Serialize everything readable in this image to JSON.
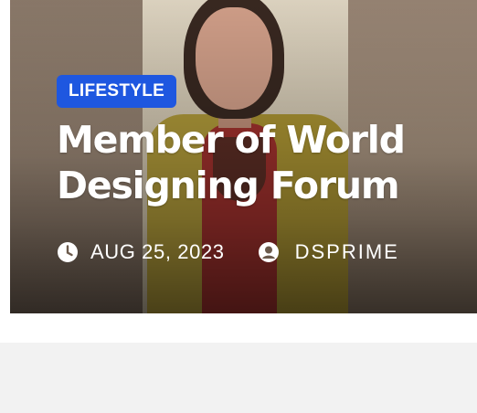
{
  "post": {
    "category": "LIFESTYLE",
    "title": "Member of World Designing Forum",
    "date": "AUG 25, 2023",
    "author": "DSPRIME"
  },
  "icons": {
    "date": "clock-icon",
    "author": "user-circle-icon"
  },
  "colors": {
    "badge": "#1e57e0",
    "text": "#ffffff",
    "footer": "#f2f2f2"
  }
}
